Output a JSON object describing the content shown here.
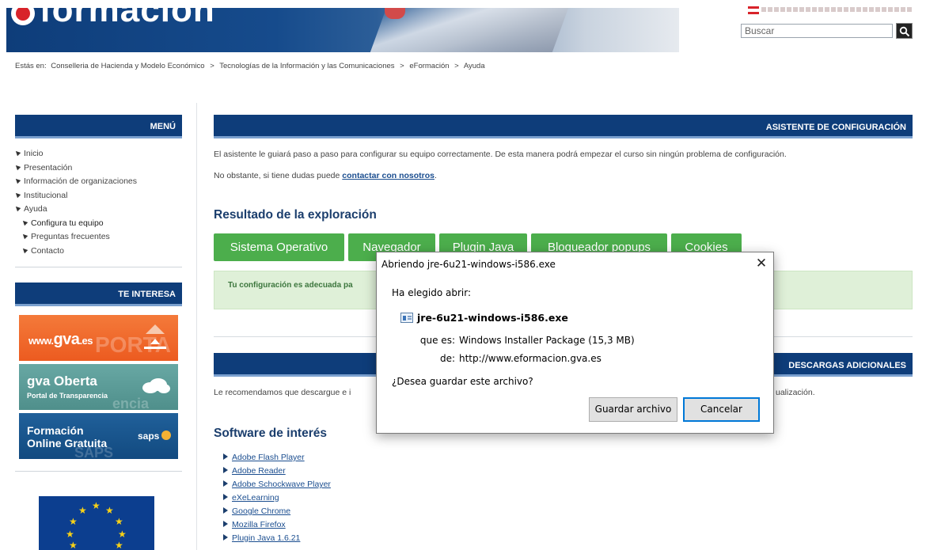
{
  "header": {
    "search": {
      "placeholder": "Buscar"
    }
  },
  "breadcrumb": {
    "prefix": "Estás en:",
    "items": [
      "Conselleria de Hacienda y Modelo Económico",
      "Tecnologías de la Información y las Comunicaciones",
      "eFormación",
      "Ayuda"
    ],
    "separator": ">"
  },
  "sidebar": {
    "menu_title": "MENÚ",
    "menu_items": [
      {
        "label": "Inicio"
      },
      {
        "label": "Presentación"
      },
      {
        "label": "Información de organizaciones"
      },
      {
        "label": "Institucional"
      },
      {
        "label": "Ayuda"
      },
      {
        "label": "Configura tu equipo"
      },
      {
        "label": "Preguntas frecuentes"
      },
      {
        "label": "Contacto"
      }
    ],
    "interesa_title": "TE INTERESA",
    "banners": {
      "gva": {
        "text": "www.",
        "brand": "gva",
        "suffix": ".es"
      },
      "oberta": {
        "title": "gva Oberta",
        "subtitle": "Portal de Transparencia"
      },
      "formacion": {
        "line1": "Formación",
        "line2": "Online Gratuita",
        "brand": "saps"
      }
    }
  },
  "main": {
    "asistente_title": "ASISTENTE DE CONFIGURACIÓN",
    "intro": "El asistente le guiará paso a paso para configurar su equipo correctamente. De esta manera podrá empezar el curso sin ningún problema de configuración.",
    "contact_prefix": "No obstante, si tiene dudas puede ",
    "contact_link": "contactar con nosotros",
    "contact_suffix": ".",
    "result_title": "Resultado de la exploración",
    "tabs": [
      {
        "label": "Sistema Operativo"
      },
      {
        "label": "Navegador"
      },
      {
        "label": "Plugin Java"
      },
      {
        "label": "Bloqueador popups"
      },
      {
        "label": "Cookies"
      }
    ],
    "result_message": "Tu configuración es adecuada pa",
    "descargas_title": "DESCARGAS ADICIONALES",
    "recomend_text": "Le recomendamos que descargue e i",
    "recomend_tail": "ualización.",
    "software_title": "Software de interés",
    "software": [
      "Adobe Flash Player",
      "Adobe Reader",
      "Adobe Schockwave Player",
      "eXeLearning",
      "Google Chrome",
      "Mozilla Firefox",
      "Plugin Java 1.6.21"
    ]
  },
  "dialog": {
    "title": "Abriendo jre-6u21-windows-i586.exe",
    "close_symbol": "✕",
    "chosen_label": "Ha elegido abrir:",
    "file_name": "jre-6u21-windows-i586.exe",
    "type_label": "que es:",
    "type_value": "Windows Installer Package (15,3 MB)",
    "from_label": "de:",
    "from_value": "http://www.eformacion.gva.es",
    "question": "¿Desea guardar este archivo?",
    "save_label": "Guardar archivo",
    "cancel_label": "Cancelar"
  },
  "colors": {
    "header_blue": "#0e3d7a",
    "tab_green": "#4cae4c",
    "result_bg": "#dff0d8",
    "link_blue": "#1a4d8f",
    "dialog_focus": "#0078d7"
  }
}
